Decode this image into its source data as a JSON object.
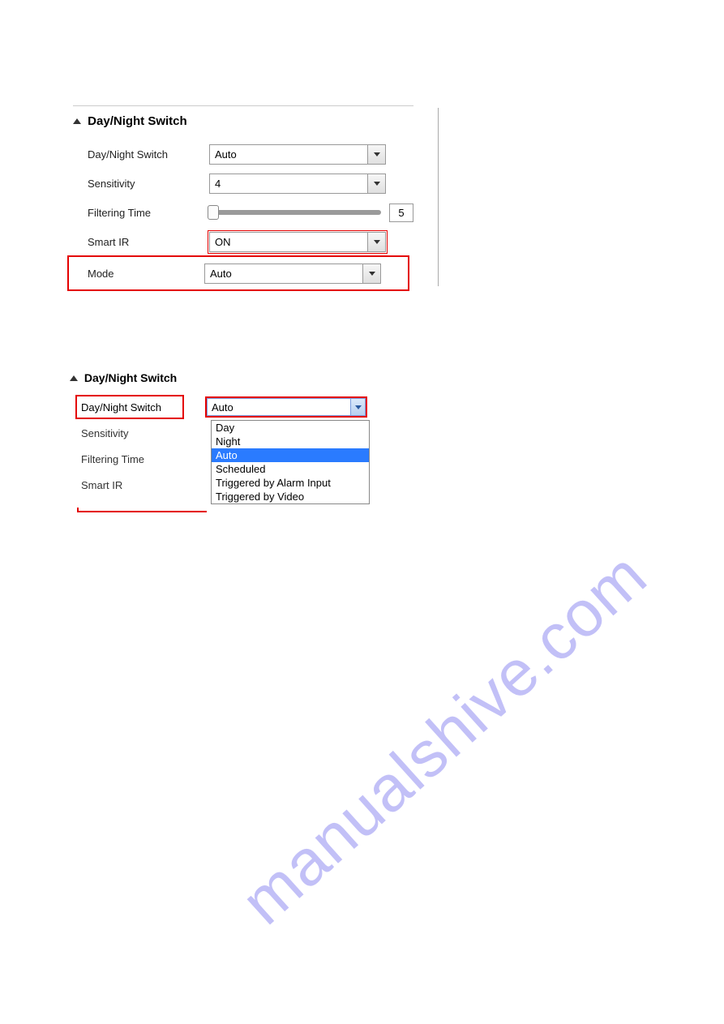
{
  "watermark": "manualshive.com",
  "section1": {
    "title": "Day/Night Switch",
    "rows": {
      "dayNightSwitch": {
        "label": "Day/Night Switch",
        "value": "Auto"
      },
      "sensitivity": {
        "label": "Sensitivity",
        "value": "4"
      },
      "filteringTime": {
        "label": "Filtering Time",
        "value": "5"
      },
      "smartIR": {
        "label": "Smart IR",
        "value": "ON"
      },
      "mode": {
        "label": "Mode",
        "value": "Auto"
      }
    }
  },
  "section2": {
    "title": "Day/Night Switch",
    "rows": {
      "dayNightSwitch": {
        "label": "Day/Night Switch",
        "value": "Auto"
      },
      "sensitivity": {
        "label": "Sensitivity"
      },
      "filteringTime": {
        "label": "Filtering Time"
      },
      "smartIR": {
        "label": "Smart IR"
      }
    },
    "dropdownOptions": [
      "Day",
      "Night",
      "Auto",
      "Scheduled",
      "Triggered by Alarm Input",
      "Triggered by Video"
    ],
    "selected": "Auto"
  }
}
